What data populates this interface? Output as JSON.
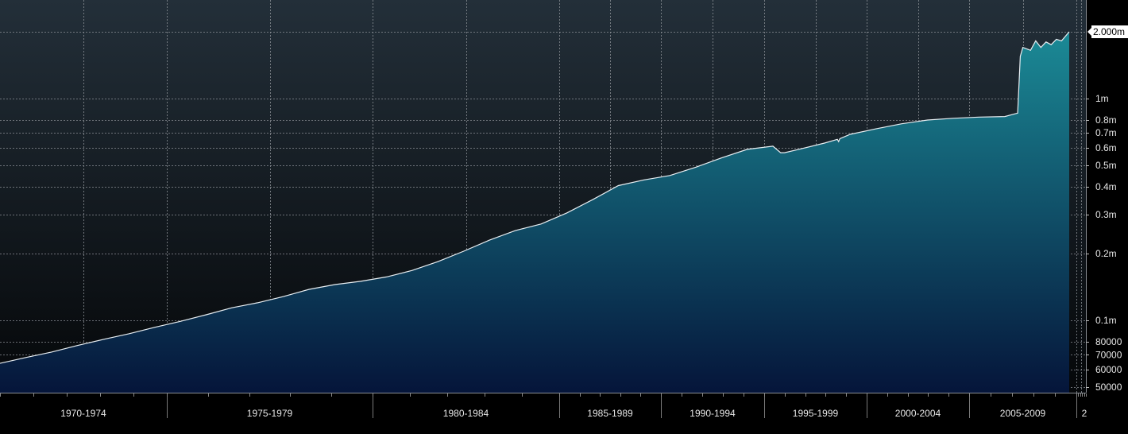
{
  "chart_data": {
    "type": "area",
    "title": "",
    "xlabel": "",
    "ylabel": "",
    "y_scale": "log",
    "ylim": [
      45000,
      2500000
    ],
    "xlim": [
      1969.0,
      2013.0
    ],
    "grid": true,
    "colors": {
      "line": "#e8eef2",
      "fill_top": "#1b8a96",
      "fill_bottom": "#05153a",
      "bg_top": "#232f39",
      "bg_bottom": "#050709",
      "grid": "#8a8f95",
      "axis_bg": "#000000",
      "divider": "#7a7a7a"
    },
    "y_ticks": [
      {
        "value": 50000,
        "label": "50000"
      },
      {
        "value": 60000,
        "label": "60000"
      },
      {
        "value": 70000,
        "label": "70000"
      },
      {
        "value": 80000,
        "label": "80000"
      },
      {
        "value": 100000,
        "label": "0.1m"
      },
      {
        "value": 200000,
        "label": "0.2m"
      },
      {
        "value": 300000,
        "label": "0.3m"
      },
      {
        "value": 400000,
        "label": "0.4m"
      },
      {
        "value": 500000,
        "label": "0.5m"
      },
      {
        "value": 600000,
        "label": "0.6m"
      },
      {
        "value": 700000,
        "label": "0.7m"
      },
      {
        "value": 800000,
        "label": "0.8m"
      },
      {
        "value": 1000000,
        "label": "1m"
      }
    ],
    "x_periods": [
      {
        "label": "1970-1974",
        "start": 1969.0,
        "end": 1975.0
      },
      {
        "label": "1975-1979",
        "start": 1975.0,
        "end": 1980.0
      },
      {
        "label": "1980-1984",
        "start": 1980.0,
        "end": 1985.0
      },
      {
        "label": "1985-1989",
        "start": 1985.0,
        "end": 1987.5
      },
      {
        "label": "1990-1994",
        "start": 1987.5,
        "end": 1990.0
      },
      {
        "label": "1995-1999",
        "start": 1990.0,
        "end": 1992.5
      },
      {
        "label": "2000-2004",
        "start": 1992.5,
        "end": 1995.0
      },
      {
        "label": "2005-2009",
        "start": 1995.0,
        "end": 2012.5
      },
      {
        "label": "2",
        "start": 2012.5,
        "end": 2013.0
      }
    ],
    "last_value": {
      "value": 2000000,
      "label": "2.000m"
    },
    "series": [
      {
        "x": [
          1969.0,
          1970.0,
          1971.0,
          1972.0,
          1973.0,
          1974.0,
          1975.0,
          1976.0,
          1977.0,
          1978.0,
          1979.0,
          1980.0,
          1981.0,
          1982.0,
          1983.0,
          1984.0,
          1985.0,
          1986.0,
          1987.0,
          1988.0,
          1989.0,
          1990.0,
          1991.0,
          1992.0,
          1993.0,
          1994.0,
          1995.0,
          1996.0,
          1997.0,
          1998.0,
          1999.0,
          1999.3,
          1999.45,
          2000.0,
          2001.0,
          2001.5,
          2001.55,
          2001.6,
          2002.0,
          2003.0,
          2004.0,
          2005.0,
          2006.0,
          2007.0,
          2008.0,
          2008.5,
          2008.6,
          2008.7,
          2009.0,
          2009.2,
          2009.4,
          2009.6,
          2009.8,
          2010.0,
          2010.2,
          2010.5
        ],
        "values": [
          64000,
          68000,
          72000,
          77000,
          82000,
          87000,
          93000,
          99000,
          106000,
          114000,
          120000,
          128000,
          138000,
          145000,
          150000,
          157000,
          168000,
          184000,
          205000,
          230000,
          254000,
          272000,
          305000,
          350000,
          405000,
          430000,
          450000,
          490000,
          540000,
          590000,
          610000,
          570000,
          570000,
          590000,
          630000,
          655000,
          640000,
          660000,
          690000,
          730000,
          770000,
          800000,
          815000,
          825000,
          830000,
          860000,
          1550000,
          1700000,
          1650000,
          1820000,
          1700000,
          1800000,
          1750000,
          1850000,
          1820000,
          2000000
        ]
      }
    ]
  }
}
